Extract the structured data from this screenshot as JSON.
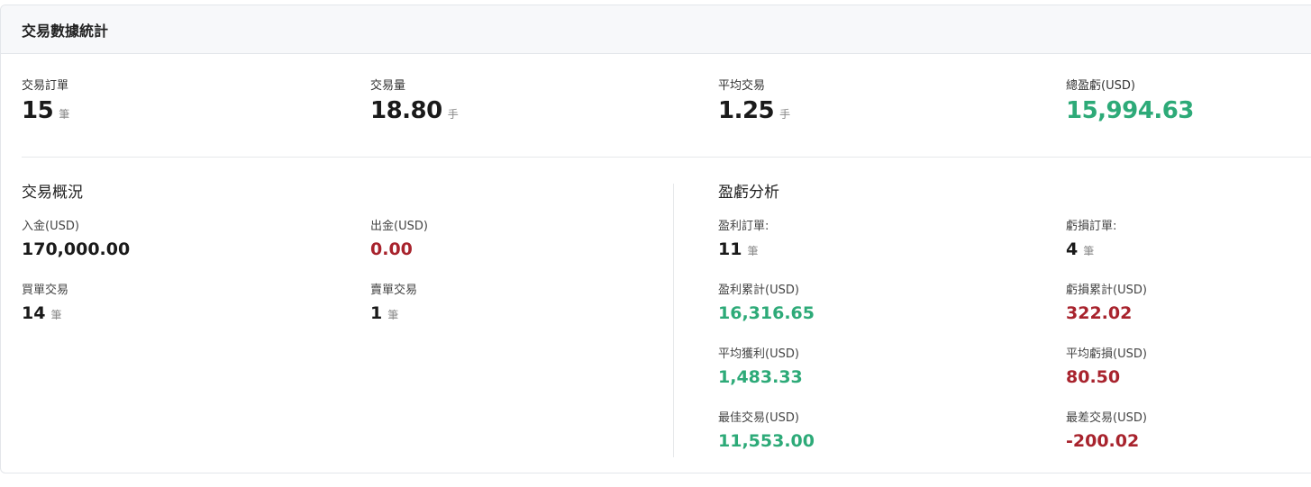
{
  "header": {
    "title": "交易數據統計"
  },
  "summary": {
    "orders": {
      "label": "交易訂單",
      "value": "15",
      "unit": "筆"
    },
    "volume": {
      "label": "交易量",
      "value": "18.80",
      "unit": "手"
    },
    "avg_trade": {
      "label": "平均交易",
      "value": "1.25",
      "unit": "手"
    },
    "total_pnl": {
      "label": "總盈虧(USD)",
      "value": "15,994.63"
    }
  },
  "overview": {
    "title": "交易概況",
    "deposit": {
      "label": "入金(USD)",
      "value": "170,000.00"
    },
    "withdrawal": {
      "label": "出金(USD)",
      "value": "0.00"
    },
    "buy_trades": {
      "label": "買單交易",
      "value": "14",
      "unit": "筆"
    },
    "sell_trades": {
      "label": "賣單交易",
      "value": "1",
      "unit": "筆"
    }
  },
  "pnl_analysis": {
    "title": "盈虧分析",
    "profit_orders": {
      "label": "盈利訂單:",
      "value": "11",
      "unit": "筆"
    },
    "loss_orders": {
      "label": "虧損訂單:",
      "value": "4",
      "unit": "筆"
    },
    "profit_total": {
      "label": "盈利累計(USD)",
      "value": "16,316.65"
    },
    "loss_total": {
      "label": "虧損累計(USD)",
      "value": "322.02"
    },
    "avg_profit": {
      "label": "平均獲利(USD)",
      "value": "1,483.33"
    },
    "avg_loss": {
      "label": "平均虧損(USD)",
      "value": "80.50"
    },
    "best_trade": {
      "label": "最佳交易(USD)",
      "value": "11,553.00"
    },
    "worst_trade": {
      "label": "最差交易(USD)",
      "value": "-200.02"
    }
  },
  "colors": {
    "positive": "#2daa78",
    "negative": "#a8232d"
  }
}
